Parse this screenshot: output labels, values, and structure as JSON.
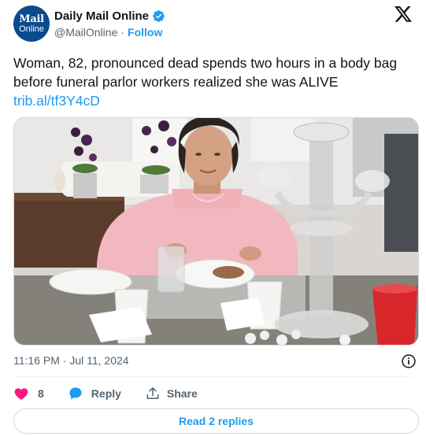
{
  "author": {
    "avatar_line1": "Mail",
    "avatar_line2": "Online",
    "display_name": "Daily Mail Online",
    "handle": "@MailOnline",
    "separator": "·",
    "follow_label": "Follow",
    "verified": true
  },
  "tweet": {
    "text": "Woman, 82, pronounced dead spends two hours in a body bag before funeral parlor workers realized she was ALIVE",
    "link": "trib.al/tf3Y4cD",
    "timestamp": "11:16 PM · Jul 11, 2024",
    "photo_icon": "photo-of-elderly-woman-at-dinner-table"
  },
  "actions": {
    "like_count": "8",
    "reply_label": "Reply",
    "share_label": "Share",
    "read_replies_label": "Read 2 replies"
  },
  "colors": {
    "accent": "#1d9bf0",
    "like": "#f91880",
    "text_primary": "#0f1419",
    "text_secondary": "#536471",
    "border": "#cfd9de",
    "avatar_bg": "#0b4a8f"
  }
}
